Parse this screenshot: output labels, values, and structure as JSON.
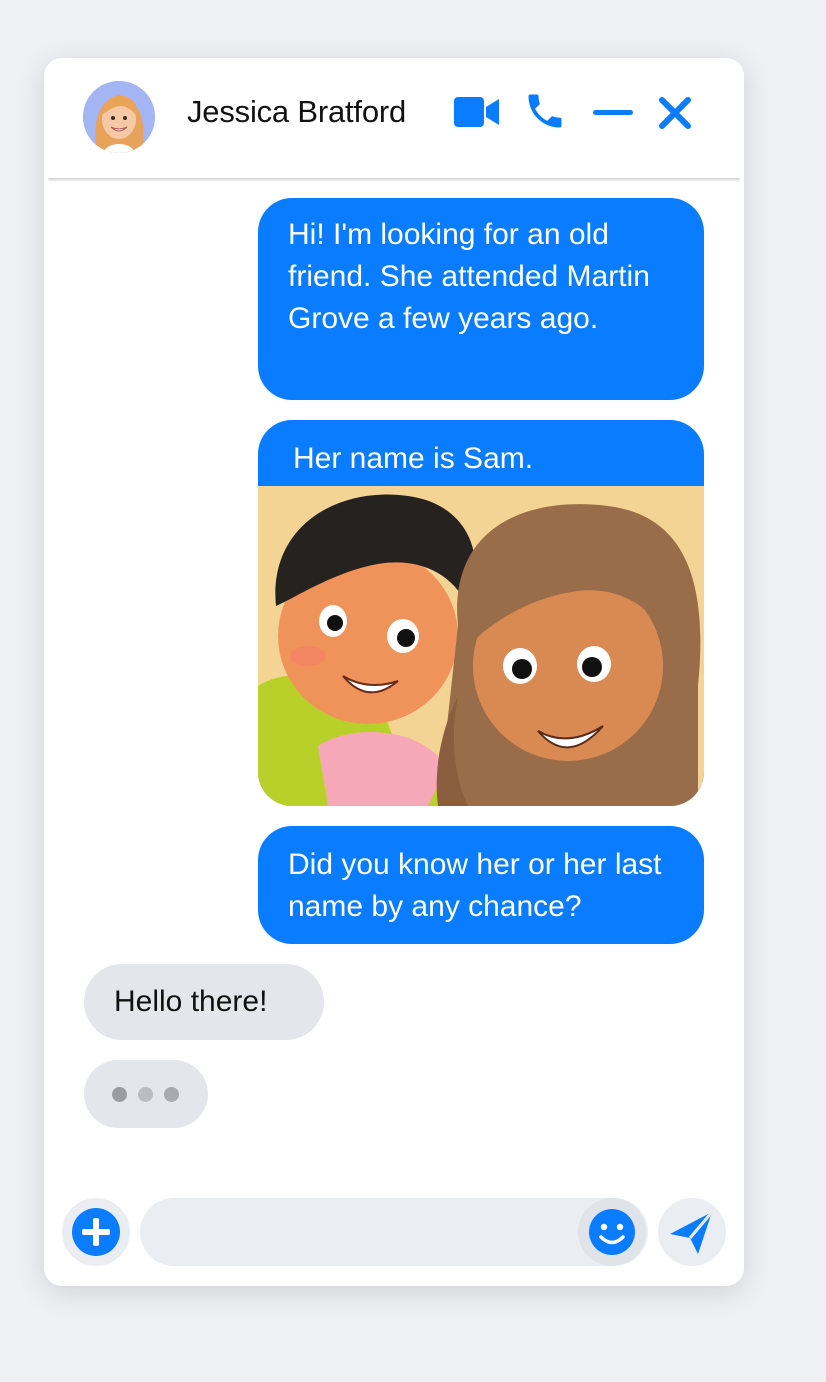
{
  "header": {
    "contact_name": "Jessica Bratford",
    "icons": [
      "video-camera-icon",
      "phone-icon",
      "minimize-icon",
      "close-icon"
    ]
  },
  "messages": {
    "outgoing_1": "Hi! I'm looking for an old friend. She attended Martin Grove a few years ago.",
    "outgoing_2_caption": "Her name is Sam.",
    "outgoing_3": "Did you know her or her last name by any chance?",
    "incoming_1": "Hello there!",
    "typing_indicator_dots": 3
  },
  "composer": {
    "input_value": "",
    "input_placeholder": "",
    "icons": [
      "add-icon",
      "emoji-icon",
      "send-icon"
    ]
  },
  "colors": {
    "accent": "#0a7cff",
    "incoming_bubble": "#e4e6eb",
    "page_background": "#eef0f3"
  }
}
